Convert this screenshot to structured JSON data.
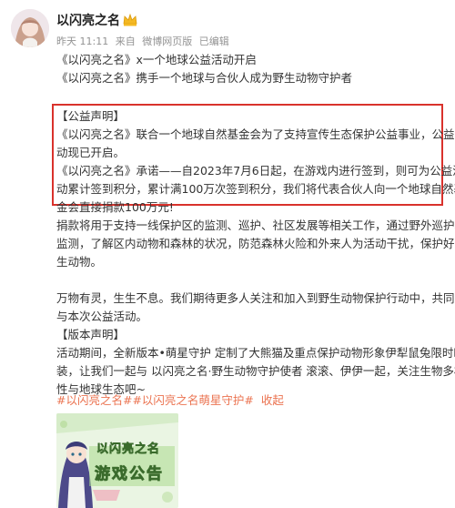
{
  "post": {
    "username": "以闪亮之名",
    "meta": {
      "time": "昨天 11:11",
      "source_prefix": "来自",
      "source": "微博网页版",
      "edited": "已编辑"
    },
    "lines": {
      "l1": "《以闪亮之名》x一个地球公益活动开启",
      "l2": "《以闪亮之名》携手一个地球与合伙人成为野生动物守护者",
      "l3": "【公益声明】",
      "l4": "《以闪亮之名》联合一个地球自然基金会为了支持宣传生态保护公益事业，公益活",
      "l5": "动现已开启。",
      "l6": "《以闪亮之名》承诺——自2023年7月6日起，在游戏内进行签到，则可为公益活",
      "l7": "动累计签到积分，累计满100万次签到积分，我们将代表合伙人向一个地球自然基",
      "l8": "金会直接捐款100万元!",
      "l9": "捐款将用于支持一线保护区的监测、巡护、社区发展等相关工作，通过野外巡护和",
      "l10": "监测，了解区内动物和森林的状况，防范森林火险和外来人为活动干扰，保护好野",
      "l11": "生动物。",
      "l12": "万物有灵，生生不息。我们期待更多人关注和加入到野生动物保护行动中，共同参",
      "l13": "与本次公益活动。",
      "l14": "【版本声明】",
      "l15": "活动期间，全新版本•萌星守护 定制了大熊猫及重点保护动物形象伊犁鼠兔限时时",
      "l16": "装，让我们一起与 以闪亮之名·野生动物守护使者 滚滚、伊伊一起，关注生物多样",
      "l17": "性与地球生态吧~"
    },
    "hashtags": [
      "#以闪亮之名#",
      "#以闪亮之名萌星守护#"
    ],
    "collapse_label": "收起",
    "image": {
      "title": "以闪亮之名",
      "subtitle": "游戏公告"
    }
  },
  "colors": {
    "accent": "#eb7350",
    "highlight_border": "#d9322c",
    "meta_text": "#939393"
  },
  "icons": {
    "vip_badge": "crown-badge-icon"
  }
}
